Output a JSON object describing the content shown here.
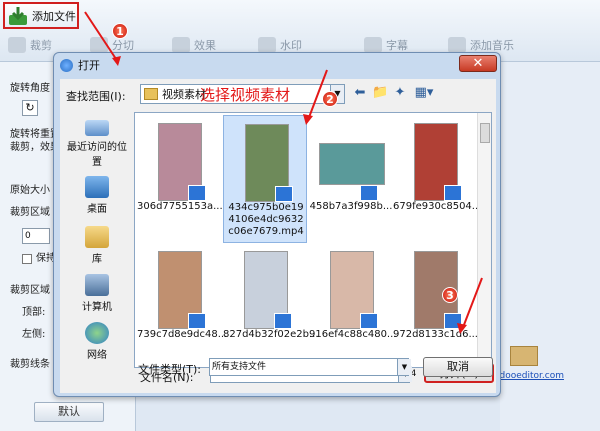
{
  "toolbar": {
    "add_file_label": "添加文件",
    "tabs": [
      {
        "label": "裁剪",
        "icon": "scissors-icon"
      },
      {
        "label": "分切",
        "icon": "split-icon"
      },
      {
        "label": "效果",
        "icon": "effect-icon"
      },
      {
        "label": "水印",
        "icon": "watermark-icon"
      },
      {
        "label": "字幕",
        "icon": "subtitle-icon"
      },
      {
        "label": "添加音乐",
        "icon": "music-icon"
      }
    ]
  },
  "left_panel": {
    "rotate_label": "旋转角度",
    "rotate_desc": "旋转将重置裁剪，效果",
    "original_size": "原始大小",
    "crop_area": "裁剪区域",
    "keep_label": "保持",
    "crop_area2": "裁剪区域",
    "top_label": "顶部:",
    "left_label": "左侧:",
    "crop_line": "裁剪线条",
    "default_btn": "默认"
  },
  "right_area": {
    "email_link": "@idooeditor.com"
  },
  "dialog": {
    "title": "打开",
    "close_symbol": "✕",
    "look_in_label": "查找范围(I):",
    "look_in_value": "视频素材",
    "places": [
      "最近访问的位置",
      "桌面",
      "库",
      "计算机",
      "网络"
    ],
    "files": [
      {
        "name": "306d7755153a...",
        "selected": false,
        "thumb_color": "#b88a9a"
      },
      {
        "name": "434c975b0e194106e4dc9632c06e7679.mp4",
        "selected": true,
        "thumb_color": "#6e8a5a"
      },
      {
        "name": "458b7a3f998b...",
        "selected": false,
        "thumb_color": "#5a9a9a"
      },
      {
        "name": "679fe930c8504...",
        "selected": false,
        "thumb_color": "#b04035"
      },
      {
        "name": "739c7d8e9dc48...",
        "selected": false,
        "thumb_color": "#c09070"
      },
      {
        "name": "827d4b32f02e2b...",
        "selected": false,
        "thumb_color": "#c8d0dc"
      },
      {
        "name": "916ef4c88c480...",
        "selected": false,
        "thumb_color": "#d8b8a8"
      },
      {
        "name": "972d8133c1d6...",
        "selected": false,
        "thumb_color": "#a07a6a"
      }
    ],
    "filename_label": "文件名(N):",
    "filename_value": "434c975b0e194106e4dc9632c06e7679.mp4",
    "filetype_label": "文件类型(T):",
    "filetype_value": "所有支持文件",
    "open_btn": "打开(O)",
    "cancel_btn": "取消"
  },
  "annotations": {
    "select_video": "选择视频素材",
    "markers": [
      "1",
      "2",
      "3"
    ],
    "color": "#e31818"
  }
}
